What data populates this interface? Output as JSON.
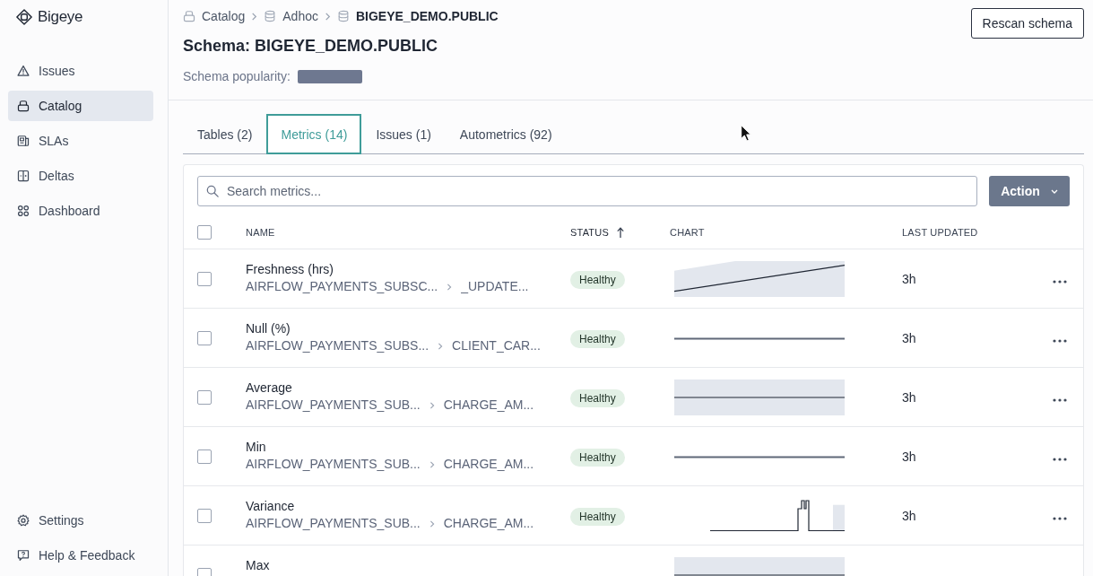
{
  "sidebar": {
    "logo": "Bigeye",
    "items": [
      {
        "label": "Issues",
        "kind": "warning",
        "selected": false
      },
      {
        "label": "Catalog",
        "kind": "catalog",
        "selected": true
      },
      {
        "label": "SLAs",
        "kind": "document",
        "selected": false
      },
      {
        "label": "Deltas",
        "kind": "split",
        "selected": false
      },
      {
        "label": "Dashboard",
        "kind": "grid",
        "selected": false
      }
    ],
    "footer_items": [
      {
        "label": "Settings",
        "kind": "gear",
        "selected": false
      },
      {
        "label": "Help & Feedback",
        "kind": "help",
        "selected": false
      }
    ]
  },
  "breadcrumb": [
    {
      "label": "Catalog",
      "kind": "catalog",
      "current": false
    },
    {
      "label": "Adhoc",
      "kind": "database",
      "current": false
    },
    {
      "label": "BIGEYE_DEMO.PUBLIC",
      "kind": "database",
      "current": true
    }
  ],
  "header": {
    "title": "Schema: BIGEYE_DEMO.PUBLIC",
    "popularity_label": "Schema popularity:",
    "button": "Rescan schema"
  },
  "tabs": [
    {
      "label": "Tables (2)",
      "selected": false
    },
    {
      "label": "Metrics (14)",
      "selected": true
    },
    {
      "label": "Issues (1)",
      "selected": false
    },
    {
      "label": "Autometrics (92)",
      "selected": false
    }
  ],
  "metrics": {
    "search": {
      "placeholder": "Search metrics..."
    },
    "action_button": "Action",
    "select_all": {
      "checked": false
    },
    "columns": [
      {
        "label": "NAME",
        "sorted": false
      },
      {
        "label": "STATUS",
        "sorted": true
      },
      {
        "label": "CHART",
        "sorted": false
      },
      {
        "label": "LAST UPDATED",
        "sorted": false
      }
    ],
    "rows": [
      {
        "name": "Freshness (hrs)",
        "table": "AIRFLOW_PAYMENTS_SUBSC...",
        "column": "_UPDATE...",
        "status": "Healthy",
        "sparkline": {
          "kind": "trend"
        },
        "updated": "3h",
        "checked": false
      },
      {
        "name": "Null (%)",
        "table": "AIRFLOW_PAYMENTS_SUBS...",
        "column": "CLIENT_CAR...",
        "status": "Healthy",
        "sparkline": {
          "kind": "flat"
        },
        "updated": "3h",
        "checked": false
      },
      {
        "name": "Average",
        "table": "AIRFLOW_PAYMENTS_SUB...",
        "column": "CHARGE_AM...",
        "status": "Healthy",
        "sparkline": {
          "kind": "band"
        },
        "updated": "3h",
        "checked": false
      },
      {
        "name": "Min",
        "table": "AIRFLOW_PAYMENTS_SUB...",
        "column": "CHARGE_AM...",
        "status": "Healthy",
        "sparkline": {
          "kind": "flat"
        },
        "updated": "3h",
        "checked": false
      },
      {
        "name": "Variance",
        "table": "AIRFLOW_PAYMENTS_SUB...",
        "column": "CHARGE_AM...",
        "status": "Healthy",
        "sparkline": {
          "kind": "spike"
        },
        "updated": "3h",
        "checked": false
      },
      {
        "name": "Max",
        "sparkline": {
          "kind": "band"
        },
        "checked": false
      }
    ]
  }
}
